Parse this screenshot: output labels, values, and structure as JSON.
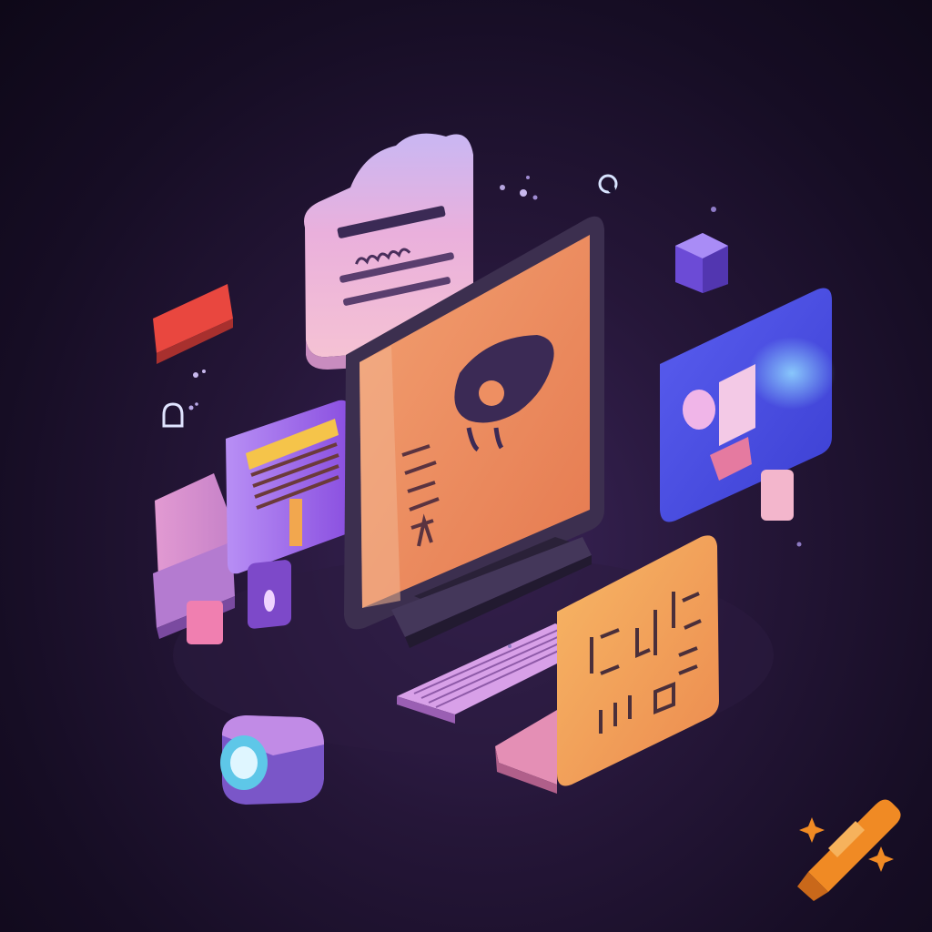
{
  "colors": {
    "background": "#1a1029",
    "monitor_screen": "#ee8f62",
    "monitor_frame": "#3c2f4f",
    "cloud_card": "#f2b7d8",
    "blue_card": "#4a4ee0",
    "red_card": "#e9473f",
    "yellow_stripes": "#f5c44a",
    "laptop_screen": "#f3a658",
    "keyboard": "#d8a0e8",
    "accent_purple": "#7d49c9"
  },
  "icons": {
    "cloud": "cloud-icon",
    "camera": "camera-icon",
    "cube": "cube-icon",
    "lock": "lock-icon",
    "watermark": "crayon-logo-icon"
  }
}
